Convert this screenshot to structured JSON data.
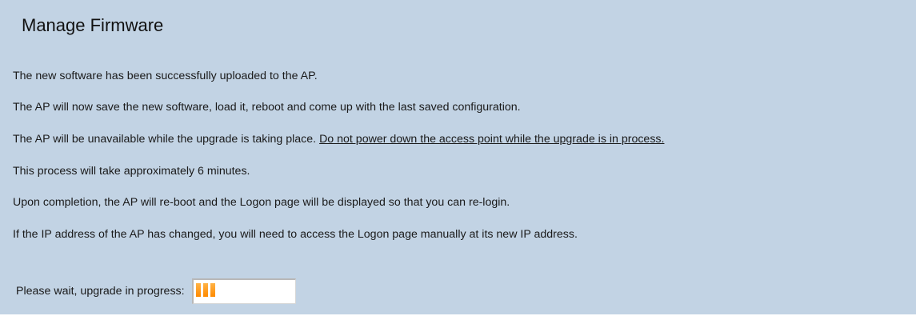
{
  "page": {
    "title": "Manage Firmware"
  },
  "messages": [
    "The new software has been successfully uploaded to the AP.",
    "The AP will now save the new software, load it, reboot and come up with the last saved configuration.",
    "The AP will be unavailable while the upgrade is taking place.",
    "Do not power down the access point while the upgrade is in process.",
    "This process will take approximately 6 minutes.",
    "Upon completion, the AP will re-boot and the Logon page will be displayed so that you can re-login.",
    "If the IP address of the AP has changed, you will need to access the Logon page manually at its new IP address."
  ],
  "progress": {
    "label": "Please wait, upgrade in progress:",
    "segments_filled": 3,
    "color": "#ff9a1a"
  },
  "colors": {
    "panel_background": "#c2d3e4"
  }
}
